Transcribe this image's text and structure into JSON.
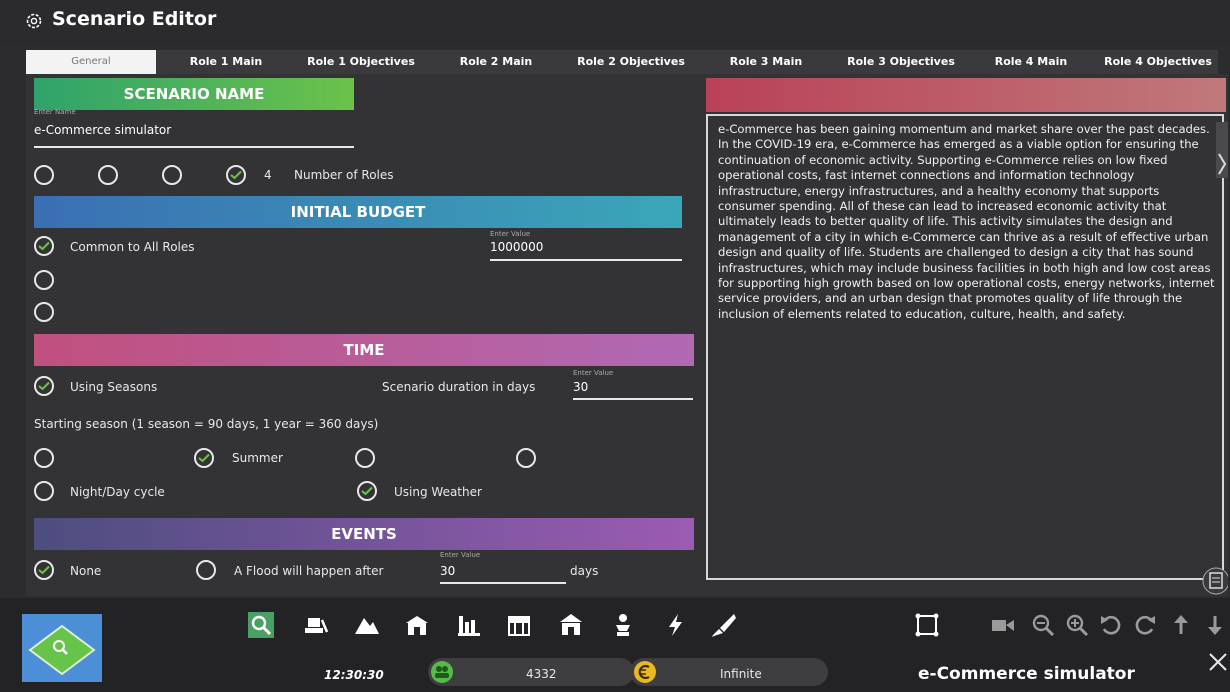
{
  "window": {
    "title": "Scenario Editor"
  },
  "tabs": [
    {
      "label": "General"
    },
    {
      "label": "Role 1 Main"
    },
    {
      "label": "Role 1 Objectives"
    },
    {
      "label": "Role 2 Main"
    },
    {
      "label": "Role 2 Objectives"
    },
    {
      "label": "Role 3 Main"
    },
    {
      "label": "Role 3 Objectives"
    },
    {
      "label": "Role 4 Main"
    },
    {
      "label": "Role 4 Objectives"
    }
  ],
  "scenario_name": {
    "header": "SCENARIO NAME",
    "placeholder": "Enter Name",
    "value": "e-Commerce simulator"
  },
  "roles": {
    "selected_count": "4",
    "label": "Number of Roles"
  },
  "initial_budget": {
    "header": "INITIAL BUDGET",
    "option_common": "Common to All Roles",
    "value_placeholder": "Enter Value",
    "value": "1000000"
  },
  "time": {
    "header": "TIME",
    "using_seasons": "Using Seasons",
    "duration_label": "Scenario duration in days",
    "duration_placeholder": "Enter Value",
    "duration_value": "30",
    "starting_season_label": "Starting season (1 season = 90 days, 1 year = 360 days)",
    "season_selected": "Summer",
    "night_day": "Night/Day cycle",
    "using_weather": "Using Weather"
  },
  "events": {
    "header": "EVENTS",
    "none": "None",
    "flood": "A Flood will happen after",
    "flood_placeholder": "Enter Value",
    "flood_value": "30",
    "days": "days"
  },
  "description": "e-Commerce has been gaining momentum and market share over the past decades. In the COVID-19 era, e-Commerce has emerged as a viable option for ensuring the continuation of economic activity. Supporting e-Commerce relies on low fixed operational costs, fast internet connections and information technology infrastructure, energy infrastructures, and a healthy economy that supports consumer spending. All of these can lead to increased economic activity that ultimately leads to better quality of life. This activity simulates the design and management of a city in which e-Commerce can thrive as a result of effective urban design and quality of life. Students are challenged to design a city that has sound infrastructures, which may include business facilities in both high and low cost areas for supporting high growth based on low operational costs, energy networks, internet service providers, and an urban design that promotes quality of life through the inclusion of elements related to education, culture, health, and safety.",
  "status": {
    "time": "12:30:30",
    "population": "4332",
    "money": "Infinite",
    "scenario": "e-Commerce simulator"
  },
  "colors": {
    "accent_green": "#6cc24a",
    "scenario_header": "#2fa36b",
    "budget_header": "#3a78b5",
    "time_header": "#c0507e",
    "events_header": "#6b4d8f"
  }
}
